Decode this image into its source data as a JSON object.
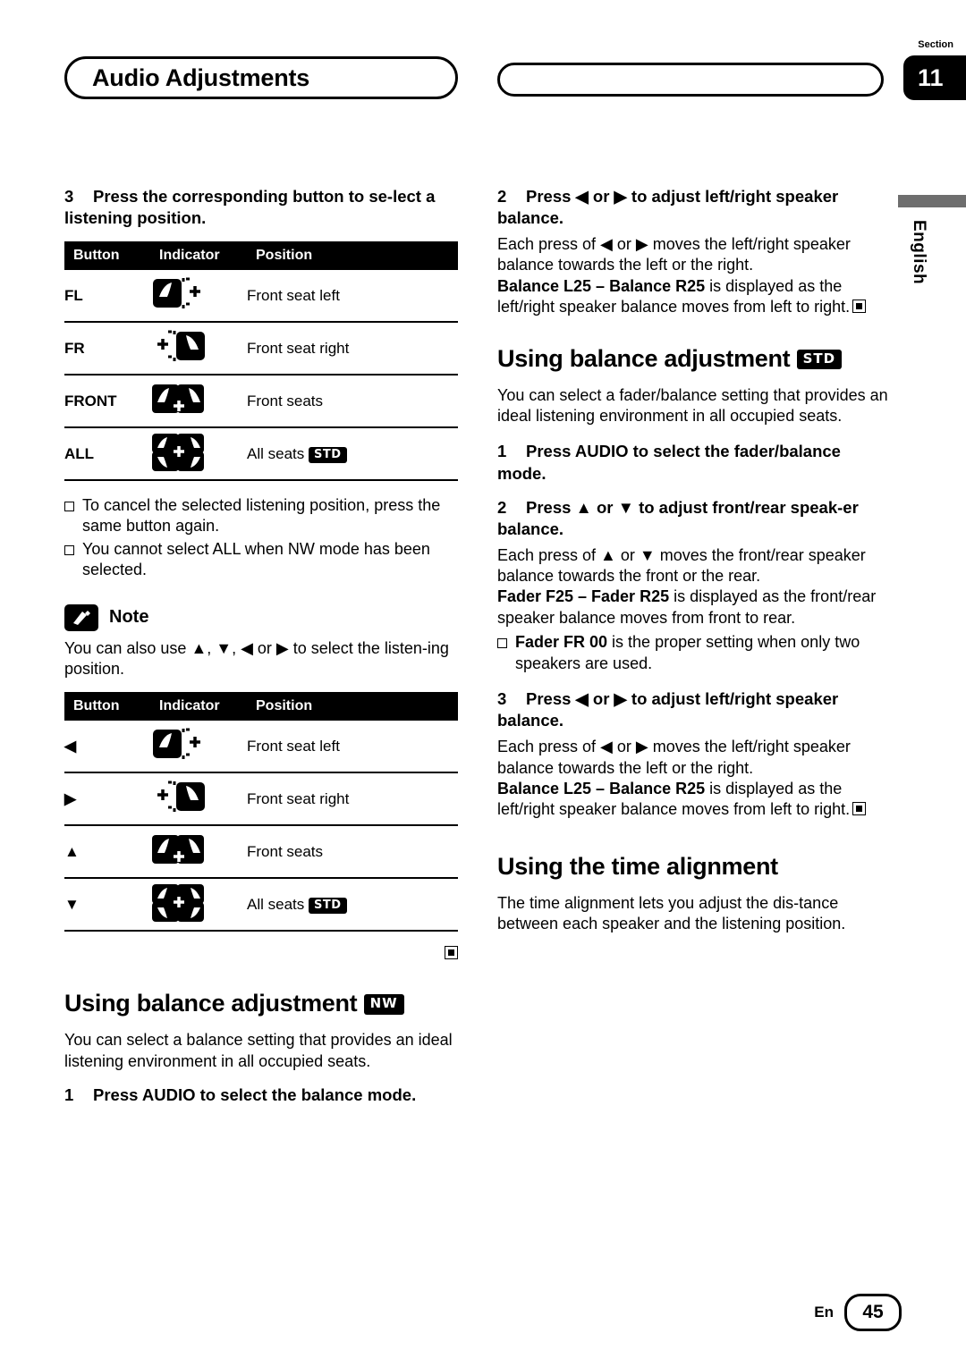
{
  "header": {
    "title": "Audio Adjustments",
    "section_word": "Section",
    "section_number": "11",
    "language": "English"
  },
  "left_column": {
    "step3": {
      "num": "3",
      "text": "Press the corresponding button to se-lect a listening position."
    },
    "table1": {
      "headers": [
        "Button",
        "Indicator",
        "Position"
      ],
      "rows": [
        {
          "button": "FL",
          "indicator": "seat-front-left-icon",
          "position": "Front seat left",
          "tag": ""
        },
        {
          "button": "FR",
          "indicator": "seat-front-right-icon",
          "position": "Front seat right",
          "tag": ""
        },
        {
          "button": "FRONT",
          "indicator": "seat-front-both-icon",
          "position": "Front seats",
          "tag": ""
        },
        {
          "button": "ALL",
          "indicator": "seat-all-icon",
          "position": "All seats",
          "tag": "STD"
        }
      ]
    },
    "bullets": [
      "To cancel the selected listening position, press the same button again.",
      "You cannot select ALL when NW mode has been selected."
    ],
    "note": {
      "title": "Note",
      "text": "You can also use ▲, ▼, ◀ or ▶ to select the listen-ing position."
    },
    "table2": {
      "headers": [
        "Button",
        "Indicator",
        "Position"
      ],
      "rows": [
        {
          "button": "◀",
          "indicator": "seat-front-left-icon",
          "position": "Front seat left",
          "tag": ""
        },
        {
          "button": "▶",
          "indicator": "seat-front-right-icon",
          "position": "Front seat right",
          "tag": ""
        },
        {
          "button": "▲",
          "indicator": "seat-front-both-icon",
          "position": "Front seats",
          "tag": ""
        },
        {
          "button": "▼",
          "indicator": "seat-all-icon",
          "position": "All seats",
          "tag": "STD"
        }
      ]
    },
    "heading_balance_nw": "Using balance adjustment",
    "heading_balance_nw_tag": "NW",
    "balance_nw_body": "You can select a balance setting that provides an ideal listening environment in all occupied seats.",
    "step1_nw": {
      "num": "1",
      "text": "Press AUDIO to select the balance mode."
    }
  },
  "right_column": {
    "step2_top": {
      "num": "2",
      "text_a": "Press ◀ or ▶ to adjust left/right speaker balance."
    },
    "step2_top_body_a": "Each press of ◀ or ▶ moves the left/right speaker balance towards the left or the right.",
    "step2_top_body_b1": "Balance L25 – Balance R25",
    "step2_top_body_b2": " is displayed as the left/right speaker balance moves from left to right.",
    "heading_balance_std": "Using balance adjustment",
    "heading_balance_std_tag": "STD",
    "balance_std_body": "You can select a fader/balance setting that provides an ideal listening environment in all occupied seats.",
    "step1": {
      "num": "1",
      "text": "Press AUDIO to select the fader/balance mode."
    },
    "step2": {
      "num": "2",
      "text": "Press ▲ or ▼ to adjust front/rear speak-er balance."
    },
    "step2_body_a": "Each press of ▲ or ▼ moves the front/rear speaker balance towards the front or the rear.",
    "step2_body_b1": "Fader F25 – Fader R25",
    "step2_body_b2": " is displayed as the front/rear speaker balance moves from front to rear.",
    "bullet_fader1": "Fader FR 00",
    "bullet_fader2": " is the proper setting when only two speakers are used.",
    "step3": {
      "num": "3",
      "text": "Press ◀ or ▶ to adjust left/right speaker balance."
    },
    "step3_body_a": "Each press of ◀ or ▶ moves the left/right speaker balance towards the left or the right.",
    "step3_body_b1": "Balance L25 – Balance R25",
    "step3_body_b2": " is displayed as the left/right speaker balance moves from left to right.",
    "heading_time_alignment": "Using the time alignment",
    "time_alignment_body": "The time alignment lets you adjust the dis-tance between each speaker and the listening position."
  },
  "footer": {
    "en": "En",
    "page": "45"
  }
}
